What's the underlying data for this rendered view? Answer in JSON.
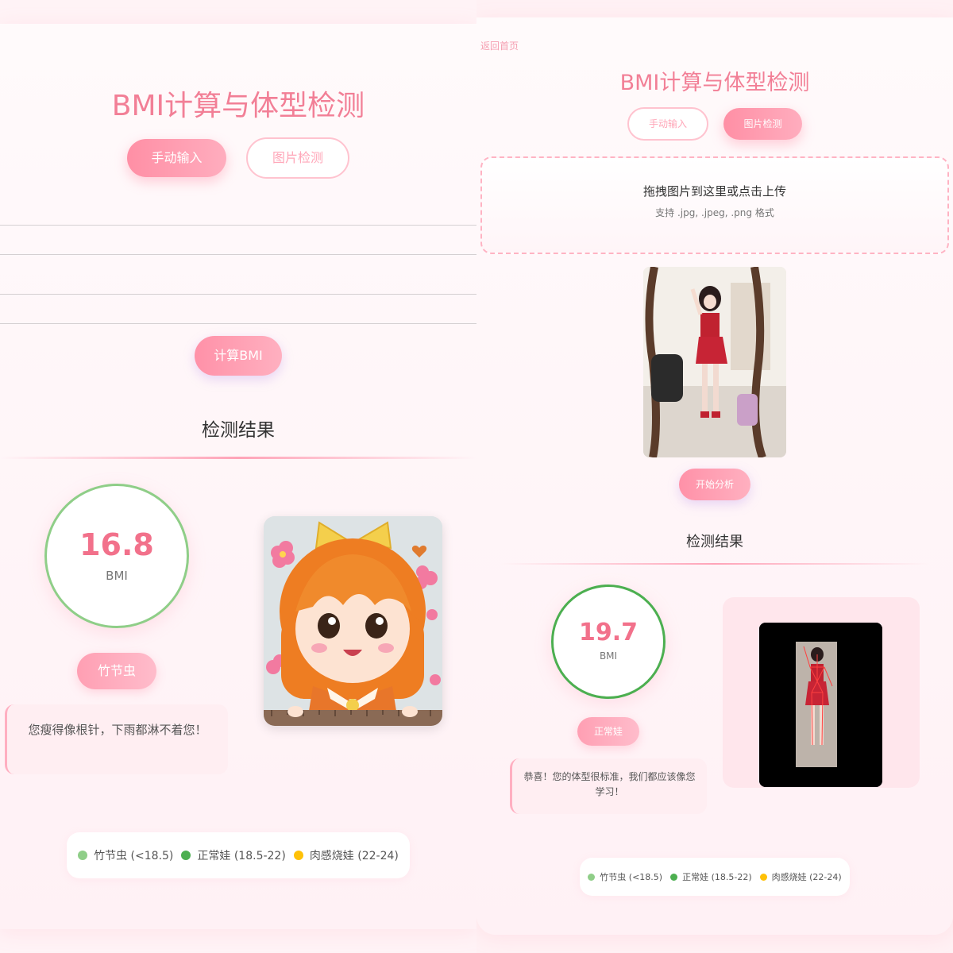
{
  "left": {
    "title": "BMI计算与体型检测",
    "tabs": {
      "manual": "手动输入",
      "image": "图片检测"
    },
    "inputs": {
      "height_value": "",
      "weight_value": ""
    },
    "calc_button": "计算BMI",
    "result": {
      "heading": "检测结果",
      "bmi_value": "16.8",
      "bmi_unit": "BMI",
      "category": "竹节虫",
      "message": "您瘦得像根针，下雨都淋不着您！",
      "ring_color": "#8fce88"
    },
    "legend": [
      {
        "label": "竹节虫 (<18.5)",
        "color": "#8fce88"
      },
      {
        "label": "正常娃 (18.5-22)",
        "color": "#4caf50"
      },
      {
        "label": "肉感烧娃 (22-24)",
        "color": "#ffc107"
      }
    ]
  },
  "right": {
    "back_link": "返回首页",
    "title": "BMI计算与体型检测",
    "tabs": {
      "manual": "手动输入",
      "image": "图片检测"
    },
    "upload": {
      "title": "拖拽图片到这里或点击上传",
      "hint": "支持 .jpg, .jpeg, .png 格式"
    },
    "analyze_button": "开始分析",
    "result": {
      "heading": "检测结果",
      "bmi_value": "19.7",
      "bmi_unit": "BMI",
      "category": "正常娃",
      "message": "恭喜！您的体型很标准，我们都应该像您学习！",
      "ring_color": "#4caf50"
    },
    "legend": [
      {
        "label": "竹节虫 (<18.5)",
        "color": "#8fce88"
      },
      {
        "label": "正常娃 (18.5-22)",
        "color": "#4caf50"
      },
      {
        "label": "肉感烧娃 (22-24)",
        "color": "#ffc107"
      }
    ]
  },
  "theme": {
    "accent": "#f27f96",
    "button_pink": "#ff91a8",
    "background": "#fff3f6"
  }
}
